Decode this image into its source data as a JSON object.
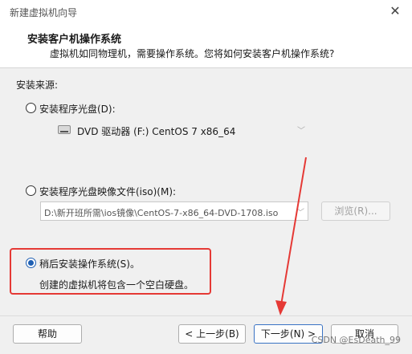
{
  "window": {
    "title": "新建虚拟机向导",
    "close_glyph": "✕"
  },
  "header": {
    "title": "安装客户机操作系统",
    "subtitle": "虚拟机如同物理机，需要操作系统。您将如何安装客户机操作系统?"
  },
  "source": {
    "label": "安装来源:",
    "option_disc": {
      "label": "安装程序光盘(D):",
      "selected": false,
      "dropdown_value": "DVD 驱动器 (F:) CentOS 7 x86_64",
      "icon": "dvd-drive-icon"
    },
    "option_iso": {
      "label": "安装程序光盘映像文件(iso)(M):",
      "selected": false,
      "path_value": "D:\\新开班所需\\ios镜像\\CentOS-7-x86_64-DVD-1708.iso",
      "browse_label": "浏览(R)..."
    },
    "option_later": {
      "label": "稍后安装操作系统(S)。",
      "selected": true,
      "description": "创建的虚拟机将包含一个空白硬盘。"
    }
  },
  "footer": {
    "help_label": "帮助",
    "back_label": "< 上一步(B)",
    "next_label": "下一步(N) >",
    "cancel_label": "取消"
  },
  "annotation_color": "#e53935",
  "watermark": "CSDN @EsDeath_99"
}
